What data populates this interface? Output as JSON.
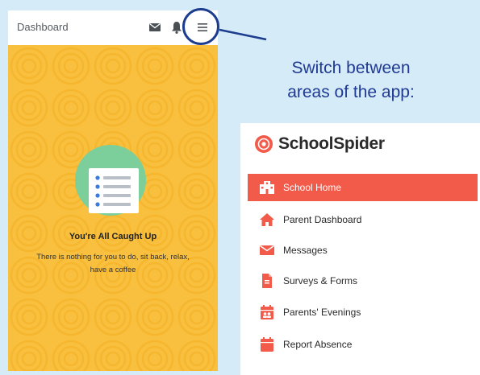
{
  "app": {
    "header_title": "Dashboard",
    "empty_state": {
      "title": "You're All Caught Up",
      "message": "There is nothing for you to do, sit back, relax, have a coffee"
    }
  },
  "annotation": {
    "caption_line1": "Switch between",
    "caption_line2": "areas of the app:"
  },
  "menu": {
    "brand_prefix": "School",
    "brand_suffix": "Spider",
    "items": [
      {
        "label": "School Home",
        "icon": "school-building-icon",
        "active": true
      },
      {
        "label": "Parent Dashboard",
        "icon": "home-icon",
        "active": false
      },
      {
        "label": "Messages",
        "icon": "envelope-icon",
        "active": false
      },
      {
        "label": "Surveys & Forms",
        "icon": "form-document-icon",
        "active": false
      },
      {
        "label": "Parents' Evenings",
        "icon": "calendar-people-icon",
        "active": false
      },
      {
        "label": "Report Absence",
        "icon": "calendar-icon",
        "active": false
      }
    ]
  },
  "colors": {
    "accent": "#f25a4a",
    "dashboard_bg": "#f8c03e",
    "annotation": "#1f3a93",
    "background": "#d6ebf8"
  }
}
